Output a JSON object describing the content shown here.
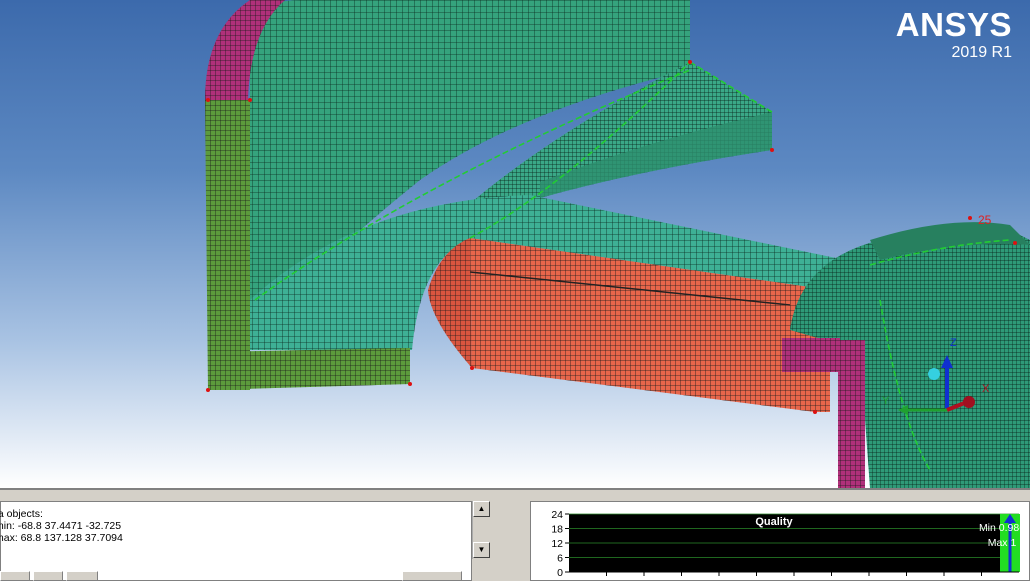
{
  "brand": {
    "name": "ANSYS",
    "version": "2019 R1"
  },
  "triad": {
    "labels": [
      "X",
      "Y",
      "Z"
    ]
  },
  "annotation": {
    "label": "25"
  },
  "colors": {
    "face_green": "#3aaa7e",
    "face_teal": "#2f9f7f",
    "face_olive": "#5a8f3a",
    "face_magenta": "#b0307a",
    "face_salmon": "#e96a4e",
    "edge_green": "#22cc33",
    "node_red": "#dd1111"
  },
  "messages": {
    "lines": [
      "ta objects:",
      "min: -68.8 37.4471 -32.725",
      "max: 68.8 137.128 37.7094"
    ]
  },
  "scroll": {
    "up": "▲",
    "down": "▼"
  },
  "chart_data": {
    "type": "bar",
    "title": "Quality",
    "y_ticks": [
      0,
      6,
      12,
      18,
      24
    ],
    "ylim": [
      0,
      24
    ],
    "xlim": [
      0,
      1
    ],
    "bins": [
      {
        "x": 0.98,
        "value": 24
      }
    ],
    "annotations": [
      "Min 0.986",
      "Max 1"
    ],
    "grid": true,
    "bar_color": "#22dd22"
  }
}
